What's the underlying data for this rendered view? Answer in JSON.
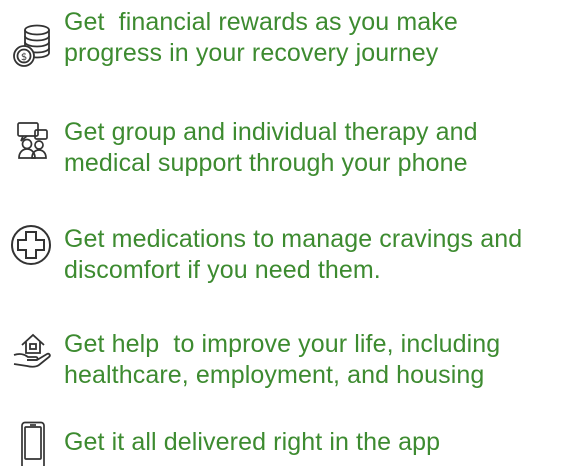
{
  "items": [
    {
      "icon": "coin-stack-icon",
      "lines": [
        "Get  financial rewards as you make",
        "progress in your recovery journey"
      ]
    },
    {
      "icon": "chat-people-icon",
      "lines": [
        "Get group and individual therapy and",
        "medical support through your phone"
      ]
    },
    {
      "icon": "medical-cross-icon",
      "lines": [
        "Get medications to manage cravings and",
        "discomfort if you need them."
      ]
    },
    {
      "icon": "house-hand-icon",
      "lines": [
        "Get help  to improve your life, including",
        "healthcare, employment, and housing"
      ]
    },
    {
      "icon": "phone-icon",
      "lines": [
        "Get it all delivered right in the app"
      ]
    }
  ]
}
